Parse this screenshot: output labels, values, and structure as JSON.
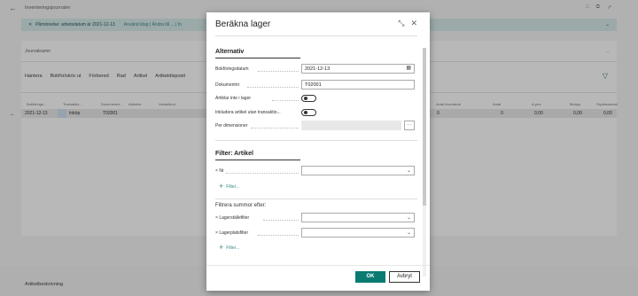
{
  "background": {
    "page_title": "Inventeringsjournaler",
    "banner": {
      "text": "Påminnelse: arbetsdatum är 2021-12-13",
      "link1": "Använd idag | Ändra till ... | In"
    },
    "journal_name_label": "Journalnamn",
    "journal_name_right": "...",
    "menu": [
      "Hantera",
      "Bokför/skriv ut",
      "Förbered",
      "Rad",
      "Artikel",
      "Artikeldisposit"
    ],
    "columns": [
      "Bokförings...",
      "Transaktio...",
      "Dokumentnr",
      "Artikelnr",
      "Variantkod",
      "Antal inventerat",
      "Antal",
      "A-pris",
      "Belopp",
      "Styckkostnad"
    ],
    "row": {
      "date": "2021-12-13",
      "type": "Inköp",
      "doc": "T02001",
      "counted": "0",
      "qty": "0",
      "unit_price": "0,00",
      "amount": "0,00",
      "unit_cost": "0,00"
    },
    "footer": "Artikelbeskrivning"
  },
  "dialog": {
    "title": "Beräkna lager",
    "sections": {
      "alternativ": "Alternativ",
      "filter_artikel": "Filter: Artikel",
      "filtrera_summor": "Filtrera summor efter:"
    },
    "fields": {
      "bokforingsdatum_label": "Bokföringsdatum",
      "bokforingsdatum_value": "2021-12-13",
      "dokumentnr_label": "Dokumentnr",
      "dokumentnr_value": "T02001",
      "artiklar_label": "Artiklar inte i lager",
      "inkludera_label": "Inkludera artikel utan transaktio...",
      "dimensioner_label": "Per dimensioner",
      "nr_label": "Nr",
      "lagerstalle_label": "Lagerställefilter",
      "lagerplats_label": "Lagerplatsfilter"
    },
    "add_filter_label": "Filter...",
    "ok_label": "OK",
    "cancel_label": "Avbryt"
  },
  "colors": {
    "accent": "#0a7a73",
    "banner_bg": "#d7eaea"
  }
}
